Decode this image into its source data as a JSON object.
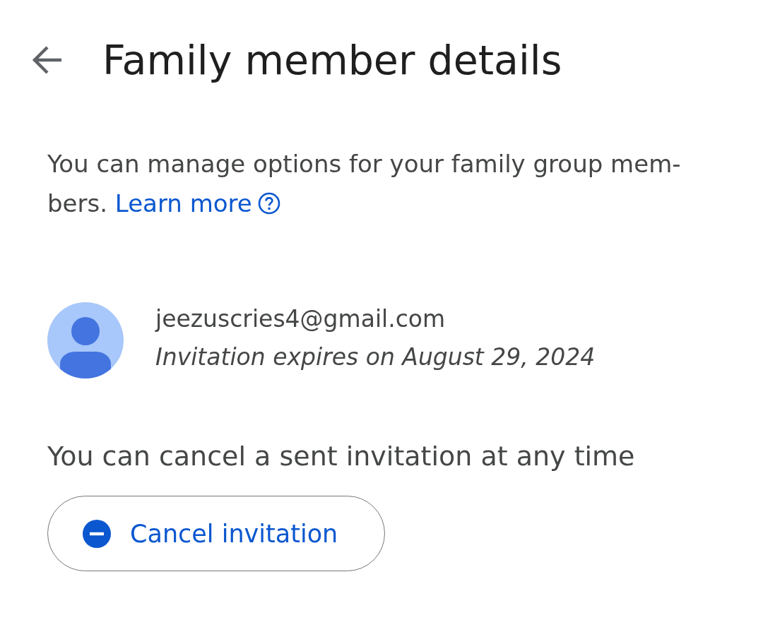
{
  "header": {
    "title": "Family member details"
  },
  "intro": {
    "text": "You can manage options for your family group mem-bers.",
    "link": "Learn more"
  },
  "member": {
    "email": "jeezuscries4@gmail.com",
    "status": "Invitation expires on August 29, 2024"
  },
  "cancel_section": {
    "note": "You can cancel a sent invitation at any time",
    "button": "Cancel invitation"
  }
}
